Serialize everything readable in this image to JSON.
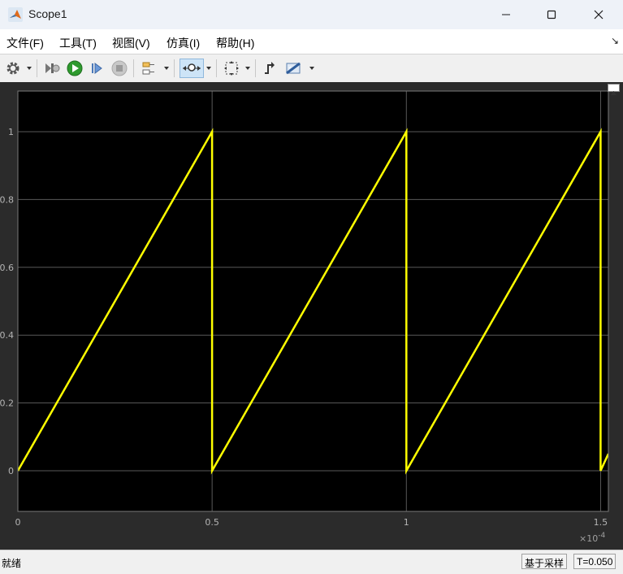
{
  "window": {
    "title": "Scope1"
  },
  "menu": [
    "文件(F)",
    "工具(T)",
    "视图(V)",
    "仿真(I)",
    "帮助(H)"
  ],
  "toolbar_icons": [
    "settings-icon",
    "restore-icon",
    "run-icon",
    "step-forward-icon",
    "stop-icon",
    "highlight-icon",
    "zoom-icon",
    "fit-icon",
    "triggers-icon",
    "measurements-icon"
  ],
  "status": {
    "left": "就绪",
    "sample_mode": "基于采样",
    "time": "T=0.050"
  },
  "colors": {
    "plot_bg": "#000000",
    "frame_bg": "#2b2b2b",
    "trace": "#ffff00",
    "grid": "#595959",
    "tick_text": "#b4b4b4"
  },
  "chart_data": {
    "type": "line",
    "x_multiplier_label": "×10",
    "x_multiplier_exp": "-4",
    "xlim": [
      0,
      1.52
    ],
    "ylim": [
      -0.12,
      1.12
    ],
    "xticks": [
      0,
      0.5,
      1,
      1.5
    ],
    "xtick_labels": [
      "0",
      "0.5",
      "1",
      "1.5"
    ],
    "yticks": [
      0,
      0.2,
      0.4,
      0.6,
      0.8,
      1
    ],
    "ytick_labels": [
      "0",
      "0.2",
      "0.4",
      "0.6",
      "0.8",
      "1"
    ],
    "grid": true,
    "series": [
      {
        "color": "#ffff00",
        "x": [
          0,
          0.5,
          0.5,
          1.0,
          1.0,
          1.5,
          1.5,
          1.52
        ],
        "y": [
          0,
          1,
          0,
          1,
          0,
          1,
          0,
          0.05
        ]
      }
    ]
  }
}
